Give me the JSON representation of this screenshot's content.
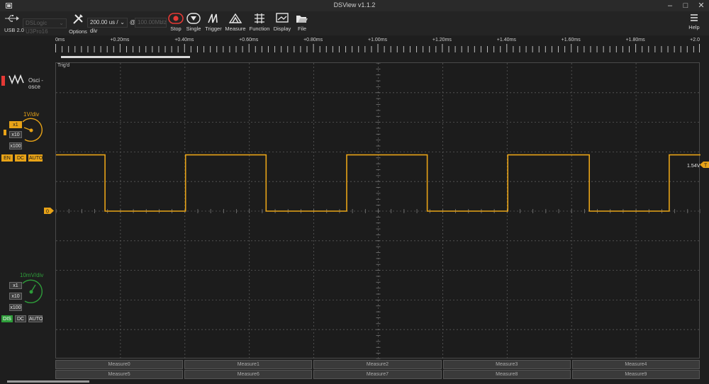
{
  "window": {
    "title": "DSView v1.1.2"
  },
  "toolbar": {
    "device_combo": "DSLogic U3Pro16",
    "usb_label": "USB 2.0",
    "options_label": "Options",
    "timebase": "200.00 us / div",
    "at_symbol": "@",
    "samplerate_combo": "100.00MHz",
    "stop_label": "Stop",
    "single_label": "Single",
    "trigger_label": "Trigger",
    "measure_label": "Measure",
    "function_label": "Function",
    "display_label": "Display",
    "file_label": "File",
    "help_label": "Help"
  },
  "ruler": {
    "labels": [
      "0ms",
      "+0.20ms",
      "+0.40ms",
      "+0.60ms",
      "+0.80ms",
      "+1.00ms",
      "+1.20ms",
      "+1.40ms",
      "+1.60ms",
      "+1.80ms",
      "+2.0"
    ]
  },
  "channel_panel": {
    "mode_label": "Osci - osce",
    "ch0": {
      "volts_per_div": "1V/div",
      "x1": "x1",
      "x10": "x10",
      "x100": "x100",
      "coupling": [
        "EN",
        "DC",
        "AUTO"
      ],
      "marker": "0"
    },
    "ch1": {
      "volts_per_div": "10mV/div",
      "x1": "x1",
      "x10": "x10",
      "x100": "x100",
      "coupling": [
        "DIS",
        "DC",
        "AUTO"
      ]
    }
  },
  "plot": {
    "trig_label": "Trig'd",
    "trigger_level_text": "1.54V",
    "trigger_marker": "T",
    "colors": {
      "ch0": "#e8a317",
      "grid": "#5a5a5a",
      "background": "#1c1c1c"
    },
    "waveform": {
      "type": "square",
      "high_level_v": 1.9,
      "low_level_v": 0,
      "transitions_ms": [
        0.0,
        0.152,
        0.402,
        0.652,
        0.902,
        1.152,
        1.402,
        1.655,
        1.903
      ]
    }
  },
  "measure": {
    "row1": [
      "Measure0",
      "Measure1",
      "Measure2",
      "Measure3",
      "Measure4"
    ],
    "row2": [
      "Measure5",
      "Measure6",
      "Measure7",
      "Measure8",
      "Measure9"
    ]
  }
}
